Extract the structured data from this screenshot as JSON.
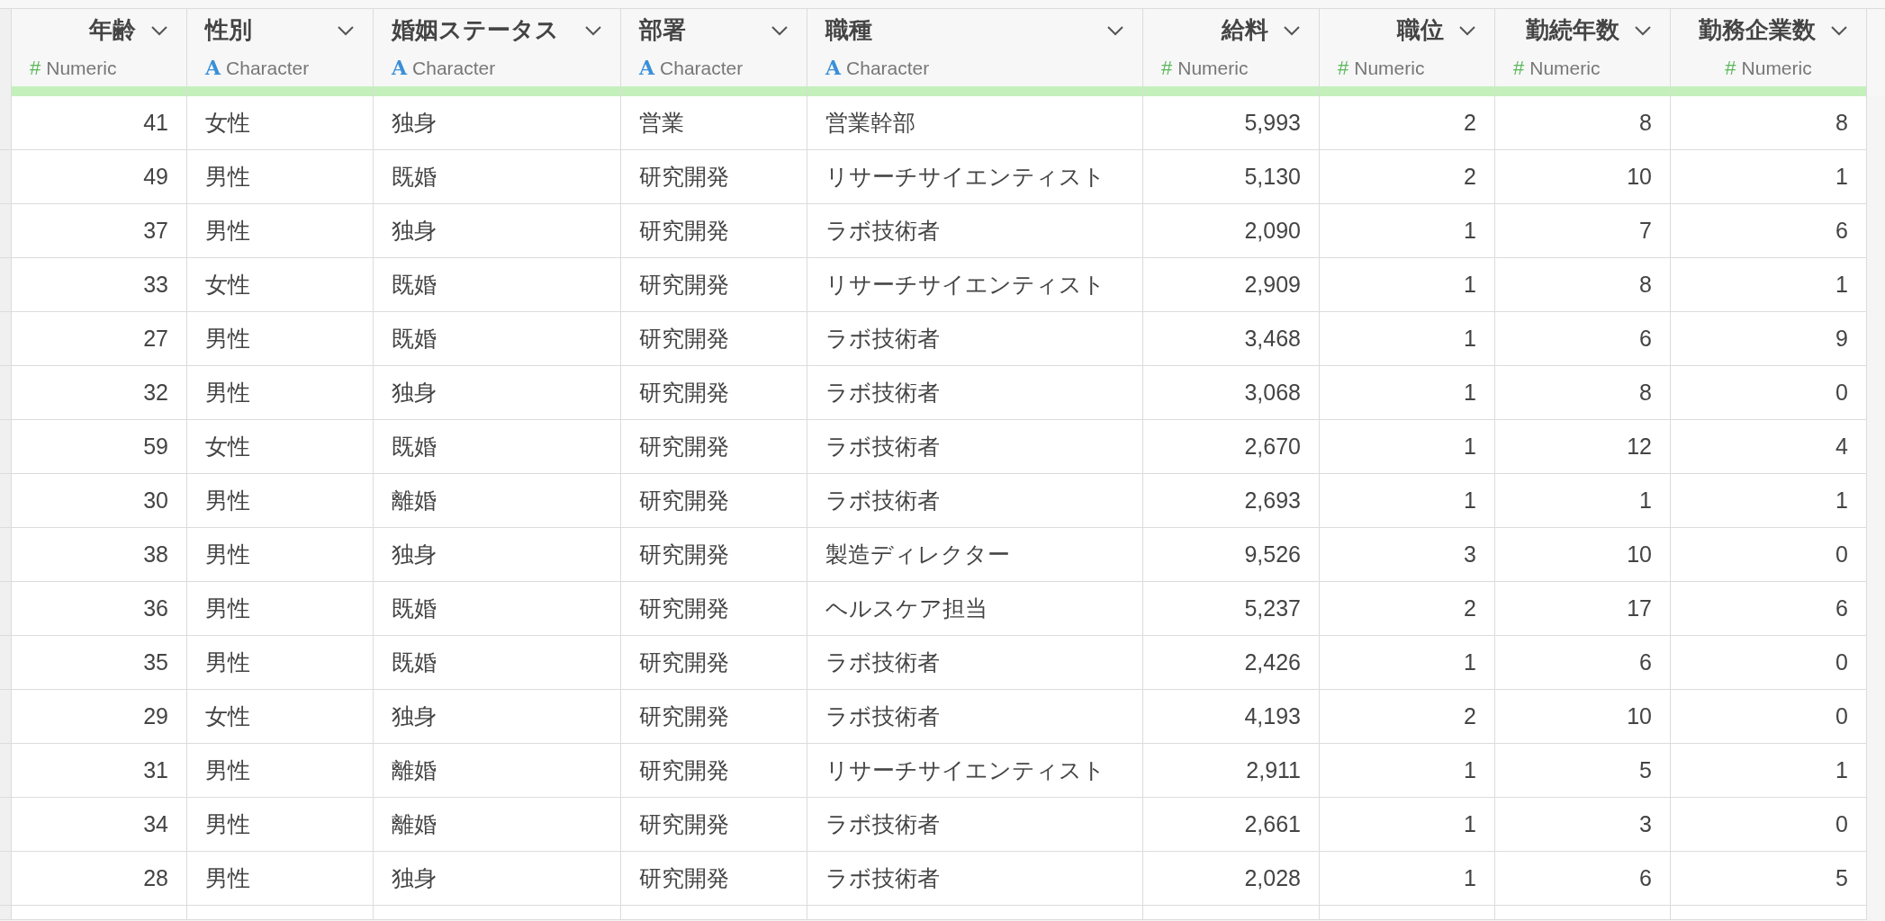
{
  "table": {
    "columns": [
      {
        "title": "年齢",
        "kind": "numeric",
        "icon": "#",
        "type": "Numeric"
      },
      {
        "title": "性別",
        "kind": "character",
        "icon": "A",
        "type": "Character"
      },
      {
        "title": "婚姻ステータス",
        "kind": "character",
        "icon": "A",
        "type": "Character"
      },
      {
        "title": "部署",
        "kind": "character",
        "icon": "A",
        "type": "Character"
      },
      {
        "title": "職種",
        "kind": "character",
        "icon": "A",
        "type": "Character"
      },
      {
        "title": "給料",
        "kind": "numeric",
        "icon": "#",
        "type": "Numeric"
      },
      {
        "title": "職位",
        "kind": "numeric",
        "icon": "#",
        "type": "Numeric"
      },
      {
        "title": "勤続年数",
        "kind": "numeric",
        "icon": "#",
        "type": "Numeric"
      },
      {
        "title": "勤務企業数",
        "kind": "numeric",
        "icon": "#",
        "type": "Numeric"
      }
    ],
    "rows": [
      [
        "41",
        "女性",
        "独身",
        "営業",
        "営業幹部",
        "5,993",
        "2",
        "8",
        "8"
      ],
      [
        "49",
        "男性",
        "既婚",
        "研究開発",
        "リサーチサイエンティスト",
        "5,130",
        "2",
        "10",
        "1"
      ],
      [
        "37",
        "男性",
        "独身",
        "研究開発",
        "ラボ技術者",
        "2,090",
        "1",
        "7",
        "6"
      ],
      [
        "33",
        "女性",
        "既婚",
        "研究開発",
        "リサーチサイエンティスト",
        "2,909",
        "1",
        "8",
        "1"
      ],
      [
        "27",
        "男性",
        "既婚",
        "研究開発",
        "ラボ技術者",
        "3,468",
        "1",
        "6",
        "9"
      ],
      [
        "32",
        "男性",
        "独身",
        "研究開発",
        "ラボ技術者",
        "3,068",
        "1",
        "8",
        "0"
      ],
      [
        "59",
        "女性",
        "既婚",
        "研究開発",
        "ラボ技術者",
        "2,670",
        "1",
        "12",
        "4"
      ],
      [
        "30",
        "男性",
        "離婚",
        "研究開発",
        "ラボ技術者",
        "2,693",
        "1",
        "1",
        "1"
      ],
      [
        "38",
        "男性",
        "独身",
        "研究開発",
        "製造ディレクター",
        "9,526",
        "3",
        "10",
        "0"
      ],
      [
        "36",
        "男性",
        "既婚",
        "研究開発",
        "ヘルスケア担当",
        "5,237",
        "2",
        "17",
        "6"
      ],
      [
        "35",
        "男性",
        "既婚",
        "研究開発",
        "ラボ技術者",
        "2,426",
        "1",
        "6",
        "0"
      ],
      [
        "29",
        "女性",
        "独身",
        "研究開発",
        "ラボ技術者",
        "4,193",
        "2",
        "10",
        "0"
      ],
      [
        "31",
        "男性",
        "離婚",
        "研究開発",
        "リサーチサイエンティスト",
        "2,911",
        "1",
        "5",
        "1"
      ],
      [
        "34",
        "男性",
        "離婚",
        "研究開発",
        "ラボ技術者",
        "2,661",
        "1",
        "3",
        "0"
      ],
      [
        "28",
        "男性",
        "独身",
        "研究開発",
        "ラボ技術者",
        "2,028",
        "1",
        "6",
        "5"
      ]
    ]
  }
}
